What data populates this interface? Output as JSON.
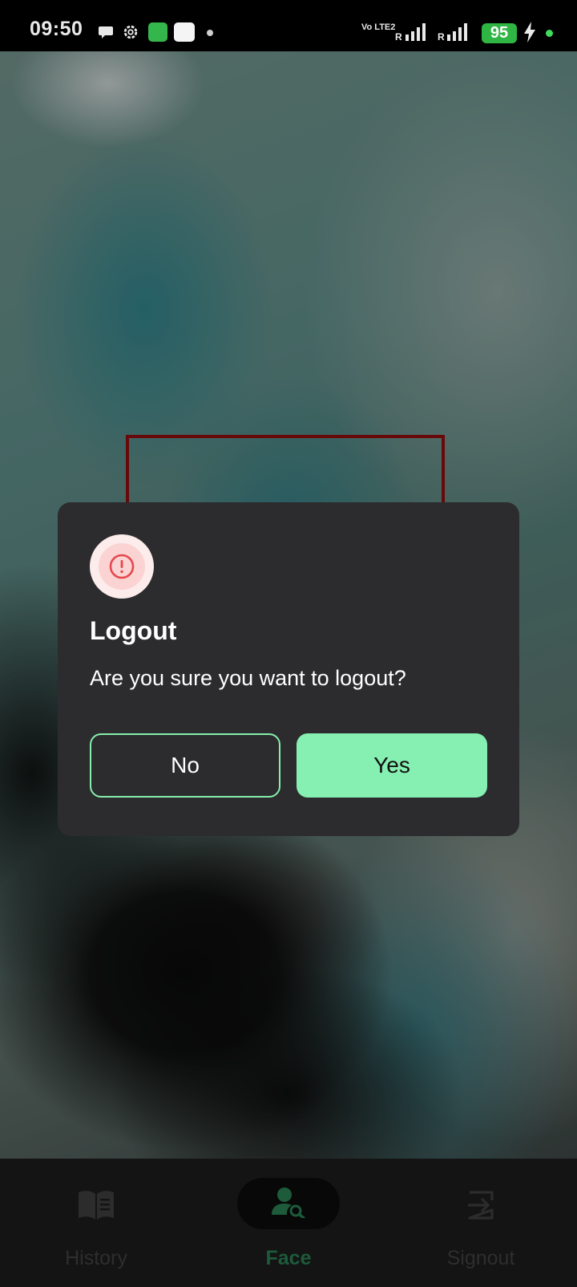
{
  "status_bar": {
    "time": "09:50",
    "battery_level": "95",
    "network_label": "Vo LTE2",
    "roaming_1": "R",
    "roaming_2": "R",
    "icons": [
      "chat-icon",
      "gear-icon",
      "app-icon",
      "app-icon",
      "notification-dot",
      "signal-icon",
      "signal-icon",
      "charging-bolt-icon"
    ]
  },
  "dialog": {
    "icon": "alert-icon",
    "title": "Logout",
    "message": "Are you sure you want to logout?",
    "no_label": "No",
    "yes_label": "Yes"
  },
  "bottom_nav": {
    "items": [
      {
        "label": "History",
        "icon": "book-icon",
        "active": false
      },
      {
        "label": "Face",
        "icon": "face-search-icon",
        "active": true
      },
      {
        "label": "Signout",
        "icon": "signout-icon",
        "active": false
      }
    ]
  },
  "colors": {
    "accent": "#86efb2",
    "dialog_bg": "#2c2c2e",
    "alert": "#e5484d",
    "face_box": "#8a0c0c",
    "nav_active": "#1d5b3b"
  }
}
